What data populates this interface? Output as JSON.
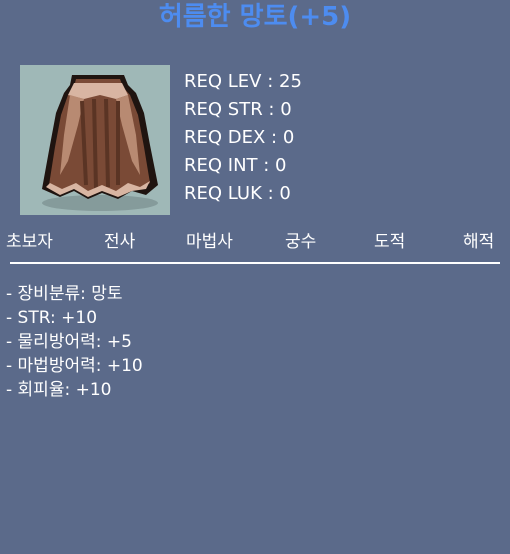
{
  "item": {
    "title": "허름한 망토(+5)",
    "icon": "cape-icon"
  },
  "requirements": [
    "REQ LEV : 25",
    "REQ STR : 0",
    "REQ DEX : 0",
    "REQ INT : 0",
    "REQ LUK : 0"
  ],
  "jobs": [
    "초보자",
    "전사",
    "마법사",
    "궁수",
    "도적",
    "해적"
  ],
  "details": [
    "- 장비분류: 망토",
    "- STR: +10",
    "- 물리방어력: +5",
    "- 마법방어력: +10",
    "- 회피율: +10"
  ],
  "colors": {
    "background": "#5b6a8a",
    "title": "#4d8cf0",
    "icon_background": "#9fb8b7"
  }
}
